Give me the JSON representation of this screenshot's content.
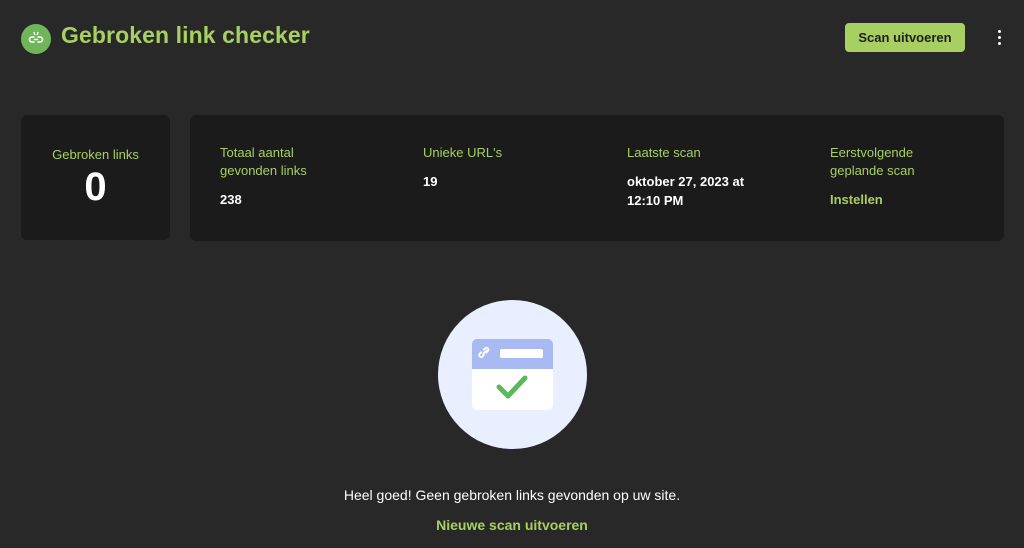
{
  "header": {
    "title": "Gebroken link checker",
    "scan_button": "Scan uitvoeren",
    "logo_icon": "broken-link-icon",
    "menu_icon": "more-vertical-icon"
  },
  "summary": {
    "broken_label": "Gebroken links",
    "broken_value": "0"
  },
  "stats": [
    {
      "label": "Totaal aantal gevonden links",
      "value": "238"
    },
    {
      "label": "Unieke URL's",
      "value": "19"
    },
    {
      "label": "Laatste scan",
      "value": "oktober 27, 2023 at 12:10 PM"
    },
    {
      "label": "Eerstvolgende geplande scan",
      "link": "Instellen"
    }
  ],
  "empty_state": {
    "illustration_icon": "link-check-icon",
    "message": "Heel goed! Geen gebroken links gevonden op uw site.",
    "action": "Nieuwe scan uitvoeren"
  },
  "colors": {
    "background": "#282828",
    "card": "#1b1b1b",
    "accent": "#a8cf62",
    "logo": "#6fb65a",
    "illustration_bg": "#e9efff",
    "illustration_header": "#a9b9f2",
    "check": "#5cb85c"
  }
}
